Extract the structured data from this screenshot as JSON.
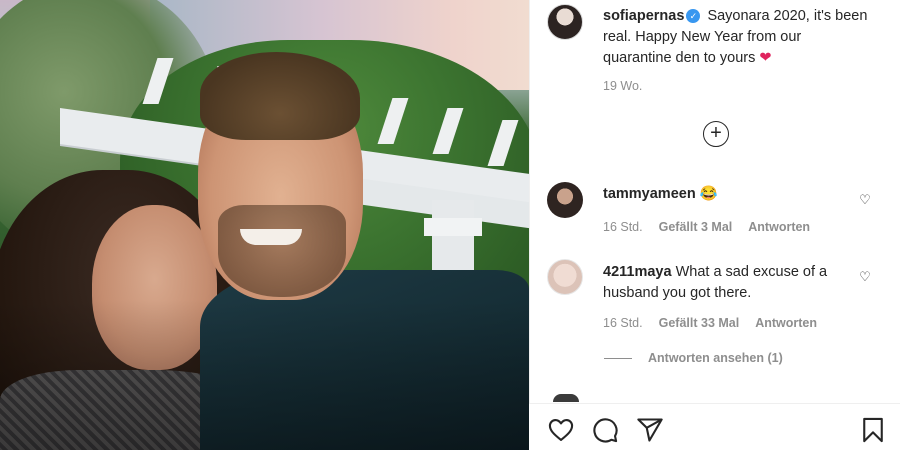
{
  "post": {
    "username": "sofiapernas",
    "verified_mark": "✓",
    "caption_text": "Sayonara 2020, it's been real. Happy New Year from our quarantine den to yours",
    "caption_emoji": "❤",
    "time_ago": "19 Wo."
  },
  "add_comment_icon": "+",
  "comments": [
    {
      "username": "tammyameen",
      "text": "",
      "emoji": "😂",
      "time": "16 Std.",
      "likes": "Gefällt 3 Mal",
      "reply": "Antworten",
      "like_icon": "♡"
    },
    {
      "username": "4211maya",
      "text": "What a sad excuse of a husband you got there.",
      "emoji": "",
      "time": "16 Std.",
      "likes": "Gefällt 33 Mal",
      "reply": "Antworten",
      "like_icon": "♡"
    }
  ],
  "view_replies": "Antworten ansehen (1)",
  "actions": {
    "like": "heart-icon",
    "comment": "comment-icon",
    "share": "share-icon",
    "save": "bookmark-icon"
  }
}
